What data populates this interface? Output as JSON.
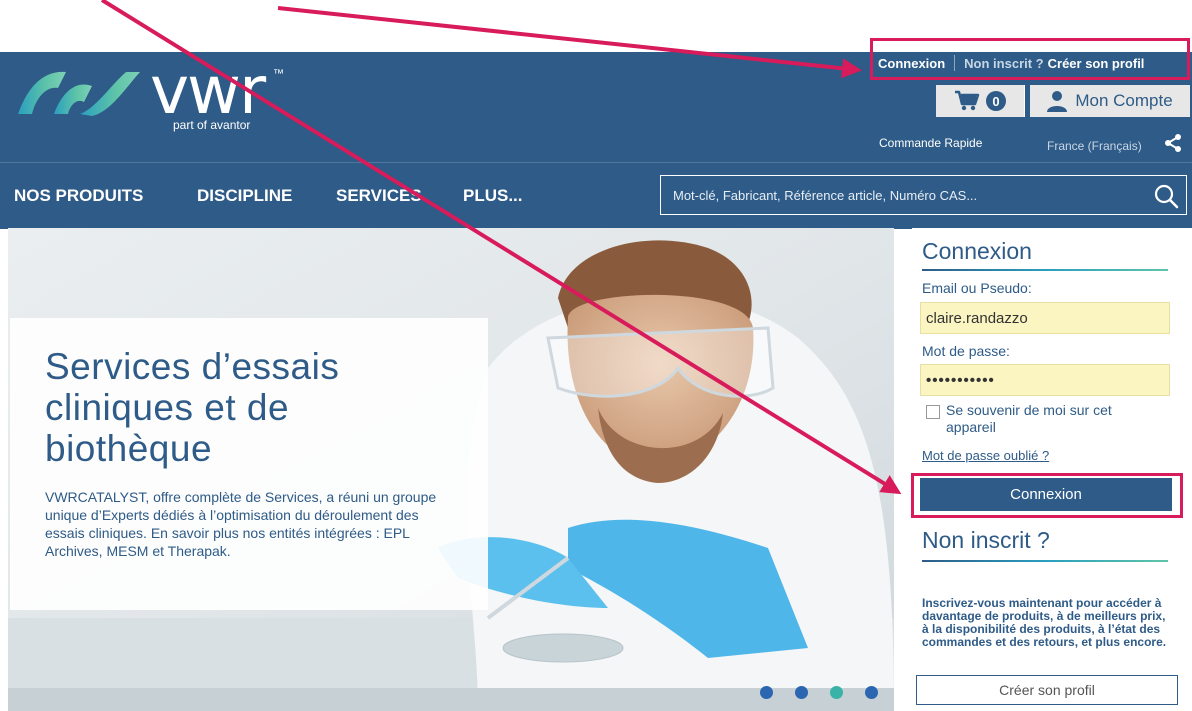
{
  "header": {
    "logo_text": "vwr",
    "logo_tm": "™",
    "logo_tagline": "part of avantor",
    "top_links": {
      "login": "Connexion",
      "not_registered": "Non inscrit ?",
      "create_profile": "Créer son profil"
    },
    "cart_count": "0",
    "account_label": "Mon Compte",
    "quick_order": "Commande Rapide",
    "locale": "France (Français)"
  },
  "nav": {
    "items": [
      "NOS PRODUITS",
      "DISCIPLINE",
      "SERVICES",
      "PLUS..."
    ],
    "search_placeholder": "Mot-clé, Fabricant, Référence article, Numéro CAS..."
  },
  "hero": {
    "title": "Services d’essais cliniques et de biothèque",
    "description": "VWRCATALYST, offre complète de Services, a réuni un groupe unique d’Experts dédiés à l’optimisation du déroulement des essais cliniques. En savoir plus nos entités intégrées : EPL Archives, MESM et Therapak.",
    "slide_count": 4,
    "active_slide": 3
  },
  "login": {
    "title": "Connexion",
    "email_label": "Email ou Pseudo:",
    "email_value": "claire.randazzo",
    "password_label": "Mot de passe:",
    "password_value": "•••••••••••",
    "remember_label": "Se souvenir de moi sur cet appareil",
    "forgot_link": "Mot de passe oublié ?",
    "button_label": "Connexion"
  },
  "register": {
    "title": "Non inscrit ?",
    "text": "Inscrivez-vous maintenant pour accéder à davantage de produits, à de meilleurs prix, à la disponibilité des produits, à l’état des commandes et des retours, et plus encore.",
    "button_label": "Créer son profil"
  },
  "colors": {
    "brand_blue": "#2e5b87",
    "annotation": "#d81b5a",
    "field_bg": "#fbf5c1"
  }
}
